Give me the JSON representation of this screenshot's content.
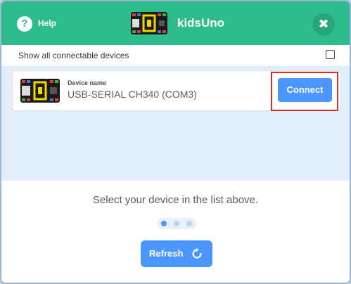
{
  "header": {
    "help_label": "Help",
    "help_icon_glyph": "?",
    "title": "kidsUno",
    "close_glyph": "✖",
    "background_color": "#2ebc8f"
  },
  "filters": {
    "show_all_label": "Show all connectable devices",
    "show_all_checked": false
  },
  "devices": [
    {
      "caption": "Device name",
      "name": "USB-SERIAL CH340 (COM3)",
      "connect_label": "Connect"
    }
  ],
  "footer": {
    "prompt": "Select your device in the list above.",
    "refresh_label": "Refresh",
    "step_count": 3,
    "active_step": 1
  },
  "colors": {
    "accent": "#4c97ff",
    "highlight_border": "#e02a2a",
    "dot_active": "#4c97ff",
    "dot_inactive": "#b8d2f5"
  }
}
